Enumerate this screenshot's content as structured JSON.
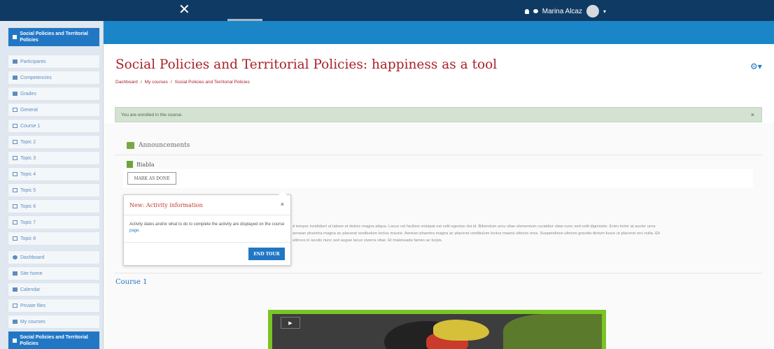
{
  "topbar": {
    "close_glyph": "✕",
    "user_name": "Marina Alcaz"
  },
  "sidebar": {
    "items": [
      {
        "label": "Social Policies and Territorial Policies",
        "icon": "graduation-cap-icon"
      },
      {
        "label": "Participants",
        "icon": "users-icon"
      },
      {
        "label": "Competencies",
        "icon": "checklist-icon"
      },
      {
        "label": "Grades",
        "icon": "table-icon"
      },
      {
        "label": "General",
        "icon": "folder-icon"
      },
      {
        "label": "Course 1",
        "icon": "folder-icon"
      },
      {
        "label": "Topic 2",
        "icon": "folder-icon"
      },
      {
        "label": "Topic 3",
        "icon": "folder-icon"
      },
      {
        "label": "Topic 4",
        "icon": "folder-icon"
      },
      {
        "label": "Topic 5",
        "icon": "folder-icon"
      },
      {
        "label": "Topic 6",
        "icon": "folder-icon"
      },
      {
        "label": "Topic 7",
        "icon": "folder-icon"
      },
      {
        "label": "Topic 8",
        "icon": "folder-icon"
      },
      {
        "label": "Dashboard",
        "icon": "dashboard-icon"
      },
      {
        "label": "Site home",
        "icon": "home-icon"
      },
      {
        "label": "Calendar",
        "icon": "calendar-icon"
      },
      {
        "label": "Private files",
        "icon": "file-icon"
      },
      {
        "label": "My courses",
        "icon": "graduation-cap-icon"
      },
      {
        "label": "Social Policies and Territorial Policies",
        "icon": "graduation-cap-icon"
      }
    ]
  },
  "page": {
    "title": "Social Policies and Territorial Policies: happiness as a tool",
    "breadcrumb": [
      "Dashboard",
      "My courses",
      "Social Policies and Territorial Policies"
    ],
    "breadcrumb_sep": "/"
  },
  "alert": {
    "text": "You are enrolled in the course.",
    "close": "×"
  },
  "content": {
    "announcements": "Announcements",
    "biabla": "Biabla",
    "mark_as_done": "MARK AS DONE",
    "lorem_lines": [
      "d tempor incididunt ut labore et dolore magna aliqua. Lacus vel facilisis volutpat est velit egestas dui id. Bibendum arcu vitae elementum curabitur vitae nunc sed velit dignissim. Enim tortor at auctor urna",
      "aenean pharetra magna ac placerat vestibulum lectus mauris. Aenean pharetra magna ac placerat vestibulum lectus mauris ultrices eros. Suspendisse ultrices gravida dictum fusce ut placerat orci nulla. Elt",
      "ultrices in iaculis nunc sed augue lacus viverra vitae. Et malesuada fames ac turpis."
    ],
    "course1_heading": "Course 1"
  },
  "tour": {
    "title": "New: Activity information",
    "close": "×",
    "body_prefix": "Activity dates and/or what to do to complete the activity are displayed on the course ",
    "body_link": "page",
    "body_suffix": ".",
    "end_tour": "END TOUR"
  },
  "colors": {
    "topbar": "#0f3a64",
    "accent": "#2277c5",
    "title": "#a8222a",
    "alert_bg": "#d4e2d2",
    "video_border": "#7ac424"
  }
}
